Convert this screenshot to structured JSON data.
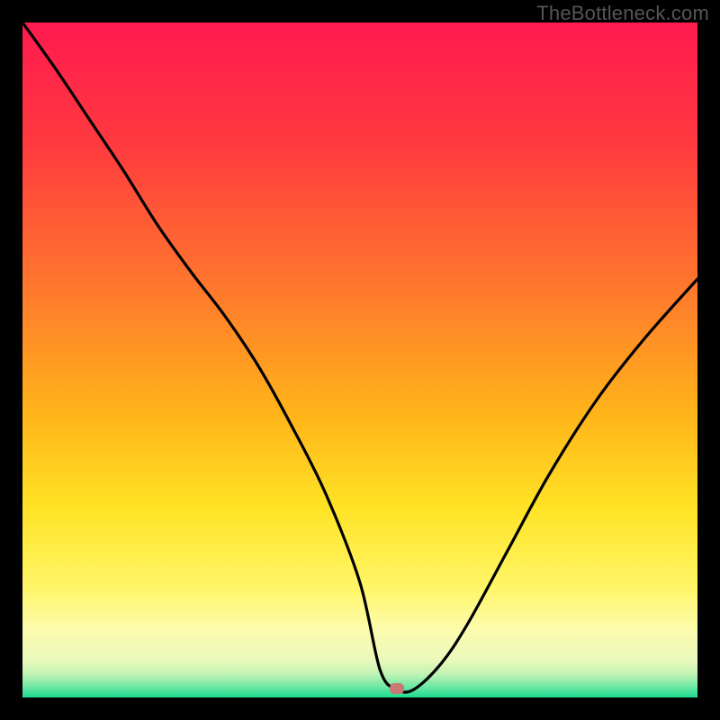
{
  "watermark": "TheBottleneck.com",
  "marker": {
    "x_frac": 0.555,
    "y_frac": 0.986
  },
  "gradient": {
    "stops": [
      {
        "offset": 0.0,
        "color": "#ff1a4f"
      },
      {
        "offset": 0.18,
        "color": "#ff3a3f"
      },
      {
        "offset": 0.4,
        "color": "#ff7a2c"
      },
      {
        "offset": 0.58,
        "color": "#ffb41a"
      },
      {
        "offset": 0.72,
        "color": "#ffe325"
      },
      {
        "offset": 0.84,
        "color": "#fff66a"
      },
      {
        "offset": 0.9,
        "color": "#fdfcae"
      },
      {
        "offset": 0.945,
        "color": "#e9f9bb"
      },
      {
        "offset": 0.965,
        "color": "#c3f3b4"
      },
      {
        "offset": 0.982,
        "color": "#77e9a6"
      },
      {
        "offset": 1.0,
        "color": "#1bdc8f"
      }
    ]
  },
  "chart_data": {
    "type": "line",
    "title": "",
    "xlabel": "",
    "ylabel": "",
    "xlim": [
      0,
      100
    ],
    "ylim": [
      0,
      100
    ],
    "series": [
      {
        "name": "curve",
        "x": [
          0,
          5,
          10,
          15,
          20,
          25,
          30,
          35,
          40,
          45,
          50,
          53,
          55.5,
          58,
          62,
          66,
          72,
          78,
          85,
          92,
          100
        ],
        "y": [
          100,
          93,
          85.5,
          78,
          70,
          63,
          56.5,
          49,
          40,
          30,
          17,
          4,
          1.2,
          1.2,
          5,
          11,
          22,
          33,
          44,
          53,
          62
        ]
      }
    ],
    "marker_point": {
      "x": 55.5,
      "y": 1.2
    }
  }
}
